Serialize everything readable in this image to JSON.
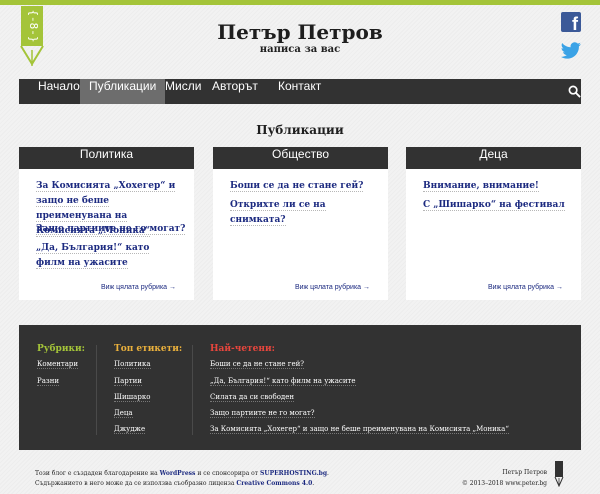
{
  "colors": {
    "accent": "#a4c439",
    "nav_bg": "#323232",
    "link": "#1c2a80",
    "footer_head_1": "#a4c439",
    "footer_head_2": "#ebb13c",
    "footer_head_3": "#e8463d"
  },
  "header": {
    "title": "Петър Петров",
    "subtitle": "написа за вас",
    "logo_icon": "pen-nib-icon",
    "social": [
      "facebook-icon",
      "twitter-icon"
    ]
  },
  "nav": {
    "items": [
      "Начало",
      "Публикации",
      "Мисли",
      "Авторът",
      "Контакт"
    ],
    "active": "Публикации",
    "search_icon": "search-icon"
  },
  "page": {
    "heading": "Публикации"
  },
  "categories": [
    {
      "title": "Политика",
      "links": [
        "За Комисията „Хохегер“ и защо не беше преименувана на Комисията „Моника“",
        "Защо партиите не го могат?",
        "„Да, България!“ като филм на ужасите"
      ],
      "more": "Виж цялата рубрика →"
    },
    {
      "title": "Общество",
      "links": [
        "Бoши се да не стане гей?",
        "Откриxте ли се на снимката?"
      ],
      "more": "Виж цялата рубрика →"
    },
    {
      "title": "Деца",
      "links": [
        "Внимание, внимание!",
        "С „Шишарко“ на фестивал"
      ],
      "more": "Виж цялата рубрика →"
    }
  ],
  "footer": {
    "rubrics": {
      "title": "Рубрики:",
      "items": [
        "Коментари",
        "Разни"
      ]
    },
    "tags": {
      "title": "Топ етикети:",
      "items": [
        "Политика",
        "Партии",
        "Шишарко",
        "Деца",
        "Джудже"
      ]
    },
    "most_read": {
      "title": "Най-четени:",
      "items": [
        "Боши се да не стане гей?",
        "„Да, България!“ като филм на ужасите",
        "Силата да си свободен",
        "Защо партиите не го могат?",
        "За Комисията „Хохегер“ и защо не беше преименувана на Комисията „Моника“"
      ]
    }
  },
  "bottom": {
    "line1_prefix": "Този блог е създаден благодарение на ",
    "line1_wp": "WordPress",
    "line1_mid": " и се спонсорира от ",
    "line1_host": "SUPERHOSTING.bg",
    "line1_end": ".",
    "line2_prefix": "Съдържанието в него може да се използва съобразно лиценза ",
    "line2_cc": "Creative Commons 4.0",
    "line2_end": ".",
    "author": "Петър Петров",
    "copyright": "© 2013–2018 www.peter.bg"
  }
}
